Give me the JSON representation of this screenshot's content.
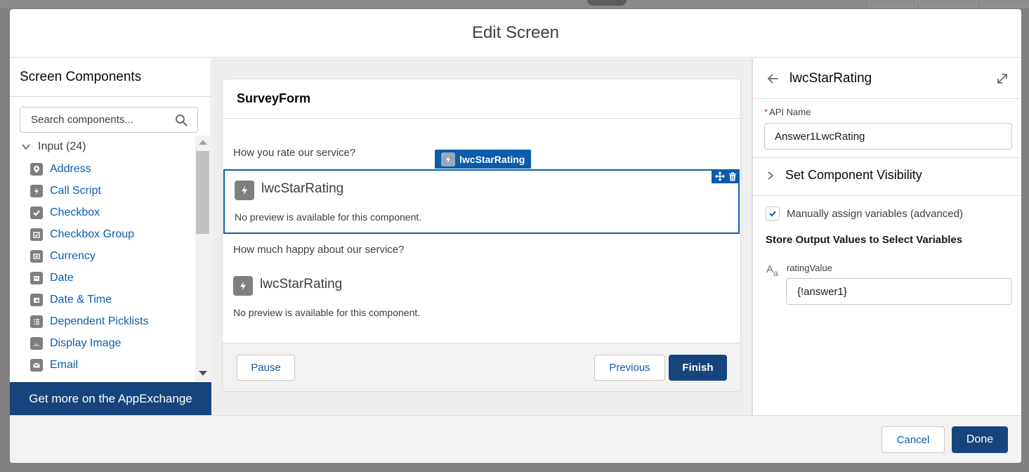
{
  "modal": {
    "title": "Edit Screen"
  },
  "left_panel": {
    "title": "Screen Components",
    "search_placeholder": "Search components...",
    "group_label": "Input (24)",
    "items": [
      {
        "label": "Address",
        "icon": "location-icon"
      },
      {
        "label": "Call Script",
        "icon": "lightning-icon"
      },
      {
        "label": "Checkbox",
        "icon": "checkbox-icon"
      },
      {
        "label": "Checkbox Group",
        "icon": "checkbox-group-icon"
      },
      {
        "label": "Currency",
        "icon": "currency-icon"
      },
      {
        "label": "Date",
        "icon": "calendar-icon"
      },
      {
        "label": "Date & Time",
        "icon": "datetime-icon"
      },
      {
        "label": "Dependent Picklists",
        "icon": "picklist-icon"
      },
      {
        "label": "Display Image",
        "icon": "image-icon"
      },
      {
        "label": "Email",
        "icon": "email-icon"
      }
    ],
    "appexchange_label": "Get more on the AppExchange"
  },
  "canvas": {
    "screen_title": "SurveyForm",
    "question1": "How you rate our service?",
    "question2": "How much happy about our service?",
    "selected_tag": "lwcStarRating",
    "component1": {
      "name": "lwcStarRating",
      "note": "No preview is available for this component."
    },
    "component2": {
      "name": "lwcStarRating",
      "note": "No preview is available for this component."
    },
    "pause_label": "Pause",
    "previous_label": "Previous",
    "finish_label": "Finish"
  },
  "right_panel": {
    "title": "lwcStarRating",
    "api_name_label": "API Name",
    "api_name_value": "Answer1LwcRating",
    "visibility_label": "Set Component Visibility",
    "manual_assign_label": "Manually assign variables (advanced)",
    "manual_assign_checked": true,
    "output_heading": "Store Output Values to Select Variables",
    "var_label": "ratingValue",
    "var_value": "{!answer1}"
  },
  "footer": {
    "cancel_label": "Cancel",
    "done_label": "Done"
  },
  "colors": {
    "brand": "#16457d",
    "link": "#0b5cab",
    "icon_gray": "#7f7f7f"
  }
}
